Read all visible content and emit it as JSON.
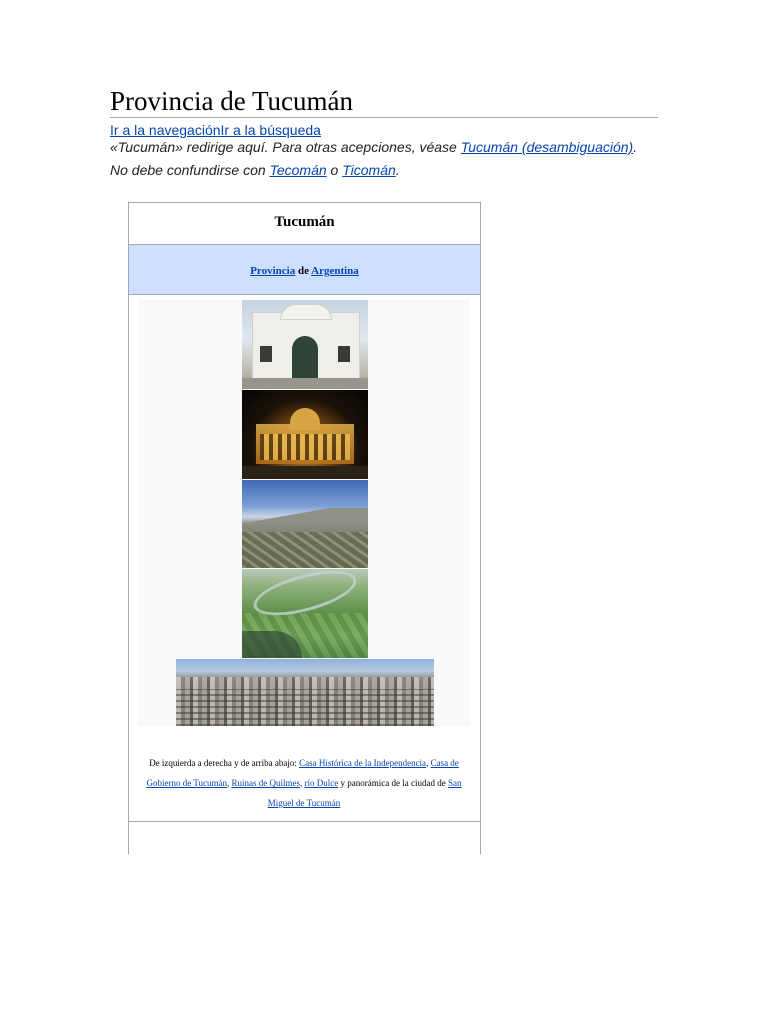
{
  "title": "Provincia de Tucumán",
  "jump": {
    "navigation": "Ir a la navegación",
    "search": "Ir a la búsqueda"
  },
  "hatnote1": {
    "prefix": "«Tucumán» redirige aquí. Para otras acepciones, véase ",
    "link": "Tucumán (desambiguación)",
    "suffix": "."
  },
  "hatnote2": {
    "prefix": "No debe confundirse con ",
    "link1": "Tecomán",
    "middle": " o ",
    "link2": "Ticomán",
    "suffix": "."
  },
  "infobox": {
    "title": "Tucumán",
    "subtitle": {
      "link1": "Provincia",
      "middle": " de ",
      "link2": "Argentina"
    },
    "images": [
      {
        "icon": "casa-historica-photo"
      },
      {
        "icon": "casa-de-gobierno-photo"
      },
      {
        "icon": "ruinas-de-quilmes-photo"
      },
      {
        "icon": "rio-dulce-photo"
      },
      {
        "icon": "san-miguel-panorama-photo"
      }
    ],
    "caption": {
      "prefix": "De izquierda a derecha y de arriba abajo: ",
      "link1": "Casa Histórica de la Independencia",
      "sep1": ", ",
      "link2": "Casa de Gobierno de Tucumán",
      "sep2": ", ",
      "link3": "Ruinas de Quilmes",
      "sep3": ", ",
      "link4": "río Dulce",
      "middle": " y panorámica de la ciudad de ",
      "link5": "San Miguel de Tucumán"
    }
  },
  "colors": {
    "link": "#0645ad",
    "subtitle_bg": "#cddeff",
    "border": "#a2a9b1"
  }
}
